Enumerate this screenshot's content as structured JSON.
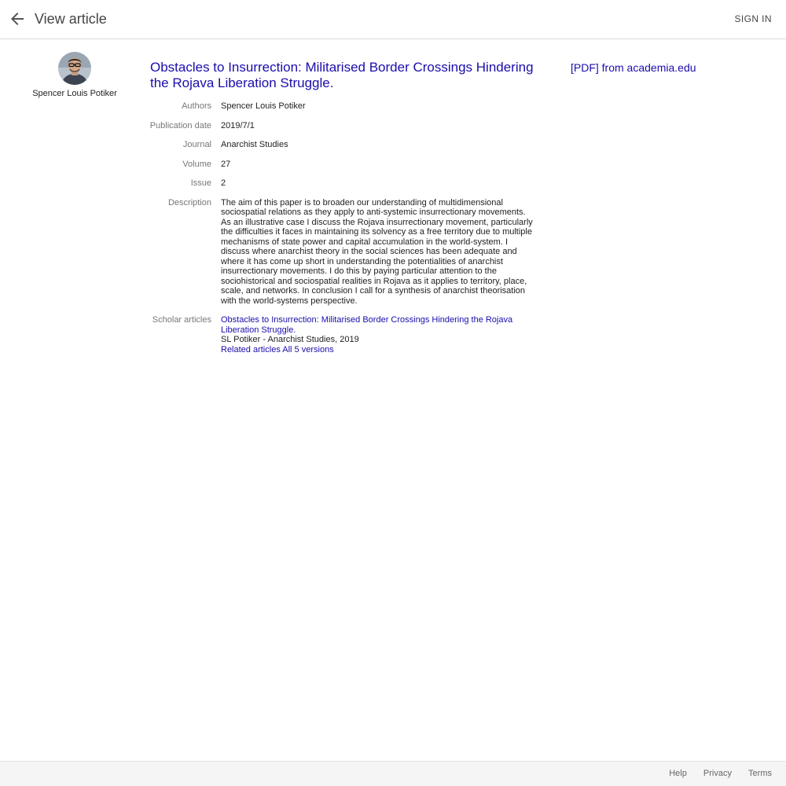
{
  "header": {
    "title": "View article",
    "sign_in": "SIGN IN"
  },
  "profile": {
    "name": "Spencer Louis Potiker"
  },
  "article": {
    "title": "Obstacles to Insurrection: Militarised Border Crossings Hindering the Rojava Liberation Struggle.",
    "pdf_link": "[PDF] from academia.edu",
    "fields": {
      "authors": {
        "label": "Authors",
        "value": "Spencer Louis Potiker"
      },
      "publication_date": {
        "label": "Publication date",
        "value": "2019/7/1"
      },
      "journal": {
        "label": "Journal",
        "value": "Anarchist Studies"
      },
      "volume": {
        "label": "Volume",
        "value": "27"
      },
      "issue": {
        "label": "Issue",
        "value": "2"
      },
      "description": {
        "label": "Description",
        "value": "The aim of this paper is to broaden our understanding of multidimensional sociospatial relations as they apply to anti-systemic insurrectionary movements. As an illustrative case I discuss the Rojava insurrectionary movement, particularly the difficulties it faces in maintaining its solvency as a free territory due to multiple mechanisms of state power and capital accumulation in the world-system. I discuss where anarchist theory in the social sciences has been adequate and where it has come up short in understanding the potentialities of anarchist insurrectionary movements. I do this by paying particular attention to the sociohistorical and sociospatial realities in Rojava as it applies to territory, place, scale, and networks. In conclusion I call for a synthesis of anarchist theorisation with the world-systems perspective."
      }
    },
    "scholar": {
      "label": "Scholar articles",
      "title": "Obstacles to Insurrection: Militarised Border Crossings Hindering the Rojava Liberation Struggle.",
      "citation": "SL Potiker - Anarchist Studies, 2019",
      "related": "Related articles",
      "versions": "All 5 versions"
    }
  },
  "footer": {
    "help": "Help",
    "privacy": "Privacy",
    "terms": "Terms"
  },
  "colors": {
    "link": "#1a0dab",
    "label": "#777777",
    "footer_bg": "#f5f5f5"
  }
}
